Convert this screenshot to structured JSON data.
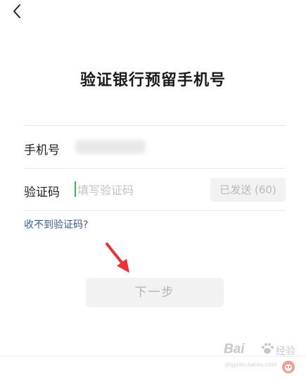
{
  "header": {
    "back_icon": "chevron-left-icon",
    "title": "验证银行预留手机号"
  },
  "form": {
    "phone_label": "手机号",
    "code_label": "验证码",
    "code_placeholder": "填写验证码",
    "code_value": "",
    "sent_button_label": "已发送 (60)",
    "help_link": "收不到验证码?"
  },
  "actions": {
    "next_label": "下一步"
  },
  "watermark": {
    "brand": "Bai",
    "cn": "经验",
    "url": "jingyan.baidu.com"
  },
  "colors": {
    "accent_cursor": "#2fbf4d",
    "link": "#3d5a8a",
    "arrow": "#e8323a",
    "disabled_bg": "#f2f2f2"
  }
}
